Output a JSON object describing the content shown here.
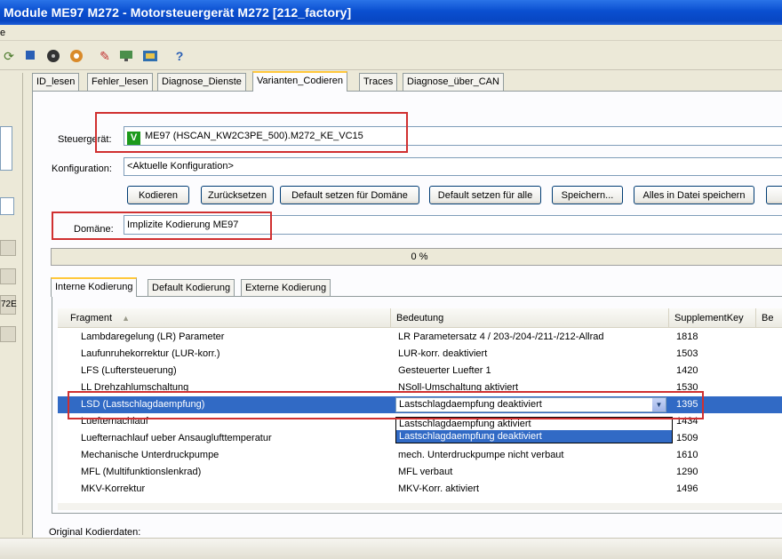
{
  "window": {
    "title": "Module ME97 M272 - Motorsteuergerät M272 [212_factory]"
  },
  "menubar": {
    "first_char": "e"
  },
  "toolbar": {
    "icons": [
      "refresh-icon",
      "stop-icon",
      "disc-icon",
      "settings-icon",
      "tool-icon",
      "network-icon",
      "chip-icon",
      "help-icon"
    ]
  },
  "leftpanel": {
    "fragment_label": "72E"
  },
  "tabs": [
    "ID_lesen",
    "Fehler_lesen",
    "Diagnose_Dienste",
    "Varianten_Codieren",
    "Traces",
    "Diagnose_über_CAN"
  ],
  "form": {
    "steuergeraet_label": "Steuergerät:",
    "steuergeraet_badge": "V",
    "steuergeraet_value": "ME97 (HSCAN_KW2C3PE_500).M272_KE_VC15",
    "konfiguration_label": "Konfiguration:",
    "konfiguration_value": "<Aktuelle Konfiguration>",
    "domaene_label": "Domäne:",
    "domaene_value": "Implizite Kodierung ME97"
  },
  "buttons": {
    "kodieren": "Kodieren",
    "zuruecksetzen": "Zurücksetzen",
    "default_domaene": "Default setzen für Domäne",
    "default_alle": "Default setzen für alle",
    "speichern": "Speichern...",
    "alles_datei": "Alles in Datei speichern"
  },
  "progress": {
    "text": "0 %",
    "value": 0
  },
  "subtabs": [
    "Interne Kodierung",
    "Default Kodierung",
    "Externe Kodierung"
  ],
  "grid": {
    "headers": [
      "Fragment",
      "Bedeutung",
      "SupplementKey",
      "Be"
    ],
    "rows": [
      {
        "fragment": "Lambdaregelung (LR) Parameter",
        "bedeutung": "LR Parametersatz 4 / 203-/204-/211-/212-Allrad",
        "key": "1818"
      },
      {
        "fragment": "Laufunruhekorrektur (LUR-korr.)",
        "bedeutung": "LUR-korr. deaktiviert",
        "key": "1503"
      },
      {
        "fragment": "LFS (Luftersteuerung)",
        "bedeutung": "Gesteuerter Luefter 1",
        "key": "1420"
      },
      {
        "fragment": "LL Drehzahlumschaltung",
        "bedeutung": "NSoll-Umschaltung aktiviert",
        "key": "1530"
      },
      {
        "fragment": "LSD (Lastschlagdaempfung)",
        "bedeutung": "Lastschlagdaempfung deaktiviert",
        "key": "1395",
        "selected": true
      },
      {
        "fragment": "Luefternachlauf",
        "bedeutung": "",
        "key": "1434"
      },
      {
        "fragment": "Luefternachlauf ueber Ansauglufttemperatur",
        "bedeutung": "",
        "key": "1509"
      },
      {
        "fragment": "Mechanische Unterdruckpumpe",
        "bedeutung": "mech. Unterdruckpumpe nicht verbaut",
        "key": "1610"
      },
      {
        "fragment": "MFL (Multifunktionslenkrad)",
        "bedeutung": "MFL verbaut",
        "key": "1290"
      },
      {
        "fragment": "MKV-Korrektur",
        "bedeutung": "MKV-Korr. aktiviert",
        "key": "1496"
      }
    ],
    "dropdown_options": [
      "Lastschlagdaempfung aktiviert",
      "Lastschlagdaempfung deaktiviert"
    ]
  },
  "footer": {
    "original_label": "Original Kodierdaten:"
  },
  "colors": {
    "title_blue": "#0a4fd0",
    "selection": "#316ac5",
    "highlight_red": "#d03030",
    "badge_green": "#1c9a1c"
  }
}
